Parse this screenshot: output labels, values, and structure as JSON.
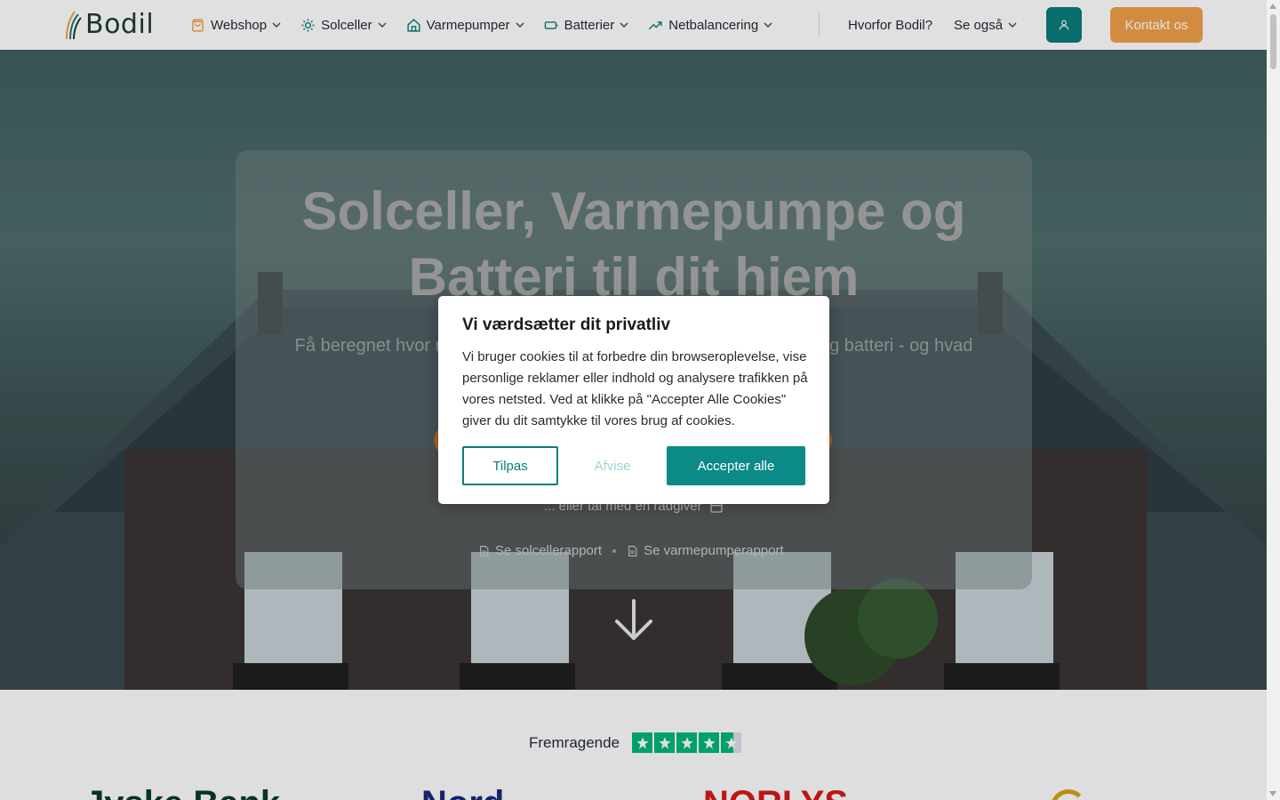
{
  "brand": {
    "name": "Bodil"
  },
  "nav": {
    "items": [
      {
        "label": "Webshop",
        "icon": "shopping-bag-icon"
      },
      {
        "label": "Solceller",
        "icon": "sun-icon"
      },
      {
        "label": "Varmepumper",
        "icon": "home-icon"
      },
      {
        "label": "Batterier",
        "icon": "battery-icon"
      },
      {
        "label": "Netbalancering",
        "icon": "trending-up-icon"
      }
    ],
    "why": "Hvorfor Bodil?",
    "see_also": "Se også",
    "contact": "Kontakt os"
  },
  "hero": {
    "title": "Solceller, Varmepumpe og Batteri til dit hjem",
    "subtitle": "Få beregnet hvor meget du kan spare med solceller, varmepumpe og batteri - og hvad der passer bedst for dig.",
    "talk_link": "... eller tal med en rådgiver",
    "report_solar": "Se solcellerapport",
    "report_heatpump": "Se varmepumperapport"
  },
  "cookie": {
    "title": "Vi værdsætter dit privatliv",
    "body": "Vi bruger cookies til at forbedre din browseroplevelse, vise personlige reklamer eller indhold og analysere trafikken på vores netsted. Ved at klikke på \"Accepter Alle Cookies\" giver du dit samtykke til vores brug af cookies.",
    "customize": "Tilpas",
    "reject": "Afvise",
    "accept": "Accepter alle"
  },
  "trust": {
    "label": "Fremragende",
    "stars": 4.5,
    "color": "#00b67a"
  },
  "partners": [
    "Jyske Bank",
    "Nord",
    "NORLYS"
  ],
  "colors": {
    "teal": "#0b7d7a",
    "orange": "#f0a04b"
  }
}
